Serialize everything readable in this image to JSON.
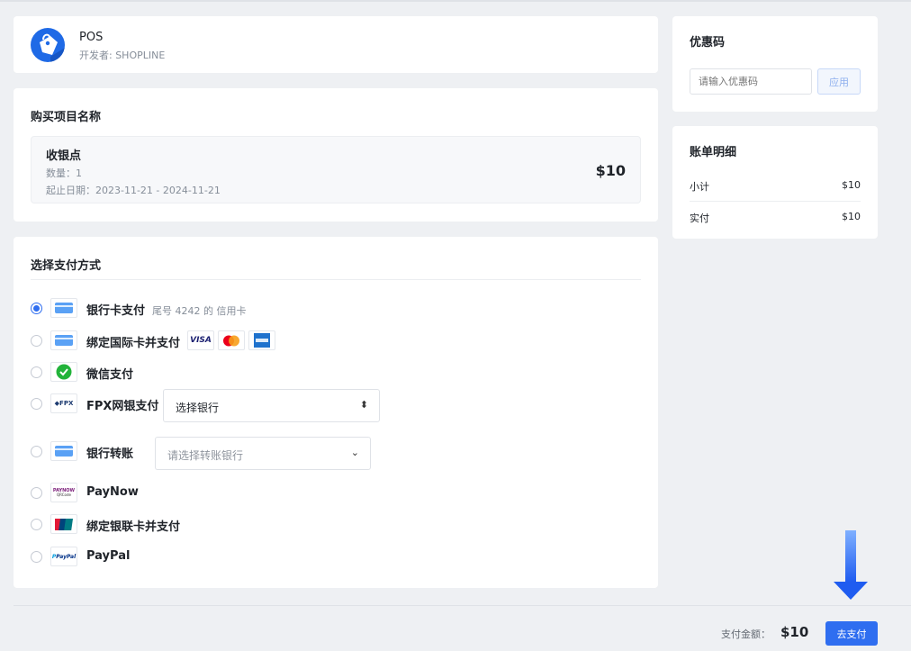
{
  "app": {
    "name": "POS",
    "developer": "开发者: SHOPLINE"
  },
  "purchase": {
    "title": "购买项目名称",
    "item_name": "收银点",
    "quantity": "数量：1",
    "date_range": "起止日期：2023-11-21 - 2024-11-21",
    "price": "$10"
  },
  "payment": {
    "title": "选择支付方式",
    "methods": [
      {
        "label": "银行卡支付",
        "sub": "尾号 4242 的 信用卡",
        "selected": true,
        "icon": "credit-card-icon"
      },
      {
        "label": "绑定国际卡并支付",
        "sub": "",
        "selected": false,
        "icon": "credit-card-icon",
        "brands": [
          "VISA",
          "mastercard",
          "amex"
        ]
      },
      {
        "label": "微信支付",
        "sub": "",
        "selected": false,
        "icon": "wechat-pay-icon"
      },
      {
        "label": "FPX网银支付",
        "sub": "",
        "selected": false,
        "icon": "fpx-icon",
        "icon_text": "FPX",
        "select_value": "选择银行"
      },
      {
        "label": "银行转账",
        "sub": "",
        "selected": false,
        "icon": "credit-card-icon",
        "select_placeholder": "请选择转账银行"
      },
      {
        "label": "PayNow",
        "sub": "",
        "selected": false,
        "icon": "paynow-icon",
        "icon_text": "PAYNOW",
        "icon_sub": "QRCode"
      },
      {
        "label": "绑定银联卡并支付",
        "sub": "",
        "selected": false,
        "icon": "unionpay-icon"
      },
      {
        "label": "PayPal",
        "sub": "",
        "selected": false,
        "icon": "paypal-icon",
        "icon_text": "PayPal"
      }
    ]
  },
  "coupon": {
    "title": "优惠码",
    "placeholder": "请输入优惠码",
    "apply_label": "应用"
  },
  "bill": {
    "title": "账单明细",
    "subtotal_label": "小计",
    "subtotal_value": "$10",
    "paid_label": "实付",
    "paid_value": "$10"
  },
  "footer": {
    "total_label": "支付金额：",
    "total_value": "$10",
    "pay_label": "去支付"
  },
  "colors": {
    "accent": "#2f6ef0",
    "background": "#eef0f3",
    "card_icon": "#5aa1f5"
  }
}
